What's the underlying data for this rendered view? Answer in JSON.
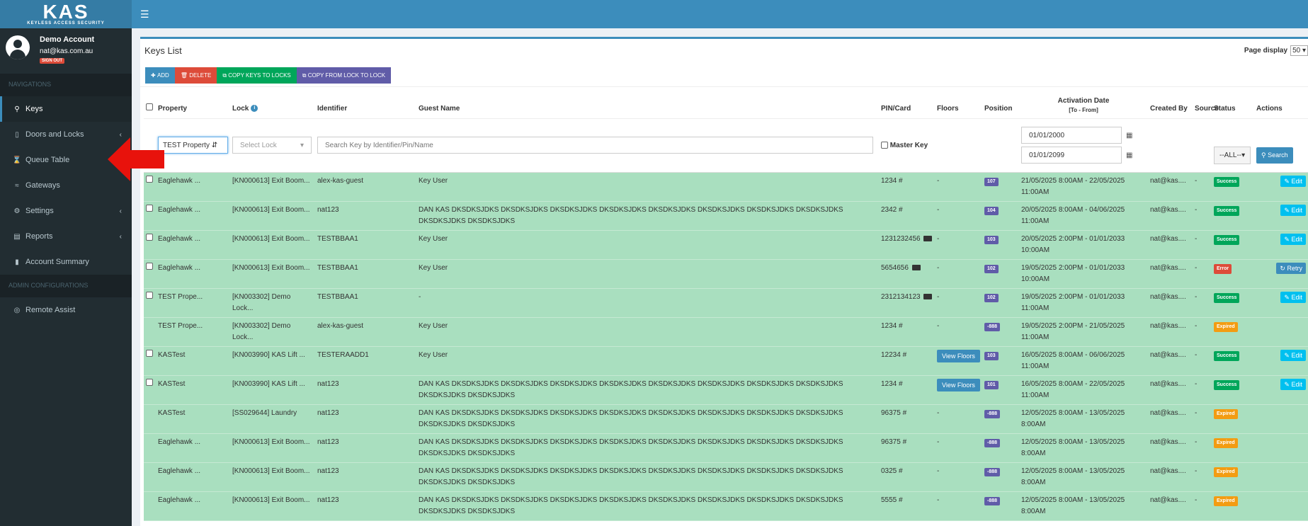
{
  "brand": {
    "logo": "KAS",
    "tagline": "KEYLESS ACCESS SECURITY"
  },
  "user": {
    "name": "Demo Account",
    "email": "nat@kas.com.au",
    "signout": "SIGN OUT"
  },
  "nav": {
    "header1": "NAVIGATIONS",
    "items": [
      {
        "label": "Keys",
        "icon": "key-icon",
        "active": true
      },
      {
        "label": "Doors and Locks",
        "icon": "door-icon",
        "chevron": true
      },
      {
        "label": "Queue Table",
        "icon": "hourglass-icon"
      },
      {
        "label": "Gateways",
        "icon": "wifi-icon"
      },
      {
        "label": "Settings",
        "icon": "cogs-icon",
        "chevron": true
      },
      {
        "label": "Reports",
        "icon": "report-icon",
        "chevron": true
      },
      {
        "label": "Account Summary",
        "icon": "bar-chart-icon"
      }
    ],
    "header2": "ADMIN CONFIGURATIONS",
    "admin_items": [
      {
        "label": "Remote Assist",
        "icon": "life-ring-icon"
      }
    ]
  },
  "page": {
    "title": "Keys List",
    "page_display_label": "Page display",
    "page_display_value": "50"
  },
  "toolbar": {
    "add": "ADD",
    "delete": "DELETE",
    "copy_keys": "COPY KEYS TO LOCKS",
    "copy_from": "COPY FROM LOCK TO LOCK"
  },
  "columns": {
    "property": "Property",
    "lock": "Lock",
    "identifier": "Identifier",
    "guest": "Guest Name",
    "pin": "PIN/Card",
    "floors": "Floors",
    "position": "Position",
    "activation": "Activation Date",
    "activation_sub": "[To - From]",
    "created": "Created By",
    "source": "Source",
    "status": "Status",
    "actions": "Actions"
  },
  "filters": {
    "property": "TEST Property",
    "lock": "Select Lock",
    "search_placeholder": "Search Key by Identifier/Pin/Name",
    "master_key": "Master Key",
    "date_from": "01/01/2000",
    "date_to": "01/01/2099",
    "status": "--ALL--",
    "search": "Search"
  },
  "rows": [
    {
      "check": true,
      "property": "Eaglehawk ...",
      "lock": "[KN000613] Exit Boom...",
      "identifier": "alex-kas-guest",
      "guest": "Key User",
      "pin": "1234 #",
      "card": false,
      "floors": "-",
      "floors_btn": false,
      "position": "107",
      "activation": "21/05/2025 8:00AM - 22/05/2025 11:00AM",
      "created": "nat@kas....",
      "source": "-",
      "status": "Success",
      "action": "Edit"
    },
    {
      "check": true,
      "property": "Eaglehawk ...",
      "lock": "[KN000613] Exit Boom...",
      "identifier": "nat123",
      "guest": "DAN KAS DKSDKSJDKS DKSDKSJDKS DKSDKSJDKS DKSDKSJDKS DKSDKSJDKS DKSDKSJDKS DKSDKSJDKS DKSDKSJDKS DKSDKSJDKS DKSDKSJDKS",
      "pin": "2342 #",
      "card": false,
      "floors": "-",
      "floors_btn": false,
      "position": "104",
      "activation": "20/05/2025 8:00AM - 04/06/2025 11:00AM",
      "created": "nat@kas....",
      "source": "-",
      "status": "Success",
      "action": "Edit"
    },
    {
      "check": true,
      "property": "Eaglehawk ...",
      "lock": "[KN000613] Exit Boom...",
      "identifier": "TESTBBAA1",
      "guest": "Key User",
      "pin": "1231232456",
      "card": true,
      "floors": "-",
      "floors_btn": false,
      "position": "103",
      "activation": "20/05/2025 2:00PM - 01/01/2033 10:00AM",
      "created": "nat@kas....",
      "source": "-",
      "status": "Success",
      "action": "Edit"
    },
    {
      "check": true,
      "property": "Eaglehawk ...",
      "lock": "[KN000613] Exit Boom...",
      "identifier": "TESTBBAA1",
      "guest": "Key User",
      "pin": "5654656",
      "card": true,
      "floors": "-",
      "floors_btn": false,
      "position": "102",
      "activation": "19/05/2025 2:00PM - 01/01/2033 10:00AM",
      "created": "nat@kas....",
      "source": "-",
      "status": "Error",
      "action": "Retry"
    },
    {
      "check": true,
      "property": "TEST Prope...",
      "lock": "[KN003302] Demo Lock...",
      "identifier": "TESTBBAA1",
      "guest": "-",
      "pin": "2312134123",
      "card": true,
      "floors": "-",
      "floors_btn": false,
      "position": "102",
      "activation": "19/05/2025 2:00PM - 01/01/2033 11:00AM",
      "created": "nat@kas....",
      "source": "-",
      "status": "Success",
      "action": "Edit"
    },
    {
      "check": false,
      "property": "TEST Prope...",
      "lock": "[KN003302] Demo Lock...",
      "identifier": "alex-kas-guest",
      "guest": "Key User",
      "pin": "1234 #",
      "card": false,
      "floors": "-",
      "floors_btn": false,
      "position": "-888",
      "activation": "19/05/2025 2:00PM - 21/05/2025 11:00AM",
      "created": "nat@kas....",
      "source": "-",
      "status": "Expired",
      "action": ""
    },
    {
      "check": true,
      "property": "KASTest",
      "lock": "[KN003990] KAS Lift ...",
      "identifier": "TESTERAADD1",
      "guest": "Key User",
      "pin": "12234 #",
      "card": false,
      "floors": "View Floors",
      "floors_btn": true,
      "position": "103",
      "activation": "16/05/2025 8:00AM - 06/06/2025 11:00AM",
      "created": "nat@kas....",
      "source": "-",
      "status": "Success",
      "action": "Edit"
    },
    {
      "check": true,
      "property": "KASTest",
      "lock": "[KN003990] KAS Lift ...",
      "identifier": "nat123",
      "guest": "DAN KAS DKSDKSJDKS DKSDKSJDKS DKSDKSJDKS DKSDKSJDKS DKSDKSJDKS DKSDKSJDKS DKSDKSJDKS DKSDKSJDKS DKSDKSJDKS DKSDKSJDKS",
      "pin": "1234 #",
      "card": false,
      "floors": "View Floors",
      "floors_btn": true,
      "position": "101",
      "activation": "16/05/2025 8:00AM - 22/05/2025 11:00AM",
      "created": "nat@kas....",
      "source": "-",
      "status": "Success",
      "action": "Edit"
    },
    {
      "check": false,
      "property": "KASTest",
      "lock": "[SS029644] Laundry",
      "identifier": "nat123",
      "guest": "DAN KAS DKSDKSJDKS DKSDKSJDKS DKSDKSJDKS DKSDKSJDKS DKSDKSJDKS DKSDKSJDKS DKSDKSJDKS DKSDKSJDKS DKSDKSJDKS DKSDKSJDKS",
      "pin": "96375 #",
      "card": false,
      "floors": "-",
      "floors_btn": false,
      "position": "-888",
      "activation": "12/05/2025 8:00AM - 13/05/2025 8:00AM",
      "created": "nat@kas....",
      "source": "-",
      "status": "Expired",
      "action": ""
    },
    {
      "check": false,
      "property": "Eaglehawk ...",
      "lock": "[KN000613] Exit Boom...",
      "identifier": "nat123",
      "guest": "DAN KAS DKSDKSJDKS DKSDKSJDKS DKSDKSJDKS DKSDKSJDKS DKSDKSJDKS DKSDKSJDKS DKSDKSJDKS DKSDKSJDKS DKSDKSJDKS DKSDKSJDKS",
      "pin": "96375 #",
      "card": false,
      "floors": "-",
      "floors_btn": false,
      "position": "-888",
      "activation": "12/05/2025 8:00AM - 13/05/2025 8:00AM",
      "created": "nat@kas....",
      "source": "-",
      "status": "Expired",
      "action": ""
    },
    {
      "check": false,
      "property": "Eaglehawk ...",
      "lock": "[KN000613] Exit Boom...",
      "identifier": "nat123",
      "guest": "DAN KAS DKSDKSJDKS DKSDKSJDKS DKSDKSJDKS DKSDKSJDKS DKSDKSJDKS DKSDKSJDKS DKSDKSJDKS DKSDKSJDKS DKSDKSJDKS DKSDKSJDKS",
      "pin": "0325 #",
      "card": false,
      "floors": "-",
      "floors_btn": false,
      "position": "-888",
      "activation": "12/05/2025 8:00AM - 13/05/2025 8:00AM",
      "created": "nat@kas....",
      "source": "-",
      "status": "Expired",
      "action": ""
    },
    {
      "check": false,
      "property": "Eaglehawk ...",
      "lock": "[KN000613] Exit Boom...",
      "identifier": "nat123",
      "guest": "DAN KAS DKSDKSJDKS DKSDKSJDKS DKSDKSJDKS DKSDKSJDKS DKSDKSJDKS DKSDKSJDKS DKSDKSJDKS DKSDKSJDKS DKSDKSJDKS DKSDKSJDKS",
      "pin": "5555 #",
      "card": false,
      "floors": "-",
      "floors_btn": false,
      "position": "-888",
      "activation": "12/05/2025 8:00AM - 13/05/2025 8:00AM",
      "created": "nat@kas....",
      "source": "-",
      "status": "Expired",
      "action": ""
    }
  ],
  "colors": {
    "brand_blue": "#3c8dbc",
    "sidebar": "#222d32",
    "row_green": "#a9dfbf",
    "annotation_arrow": "#e8120c"
  }
}
